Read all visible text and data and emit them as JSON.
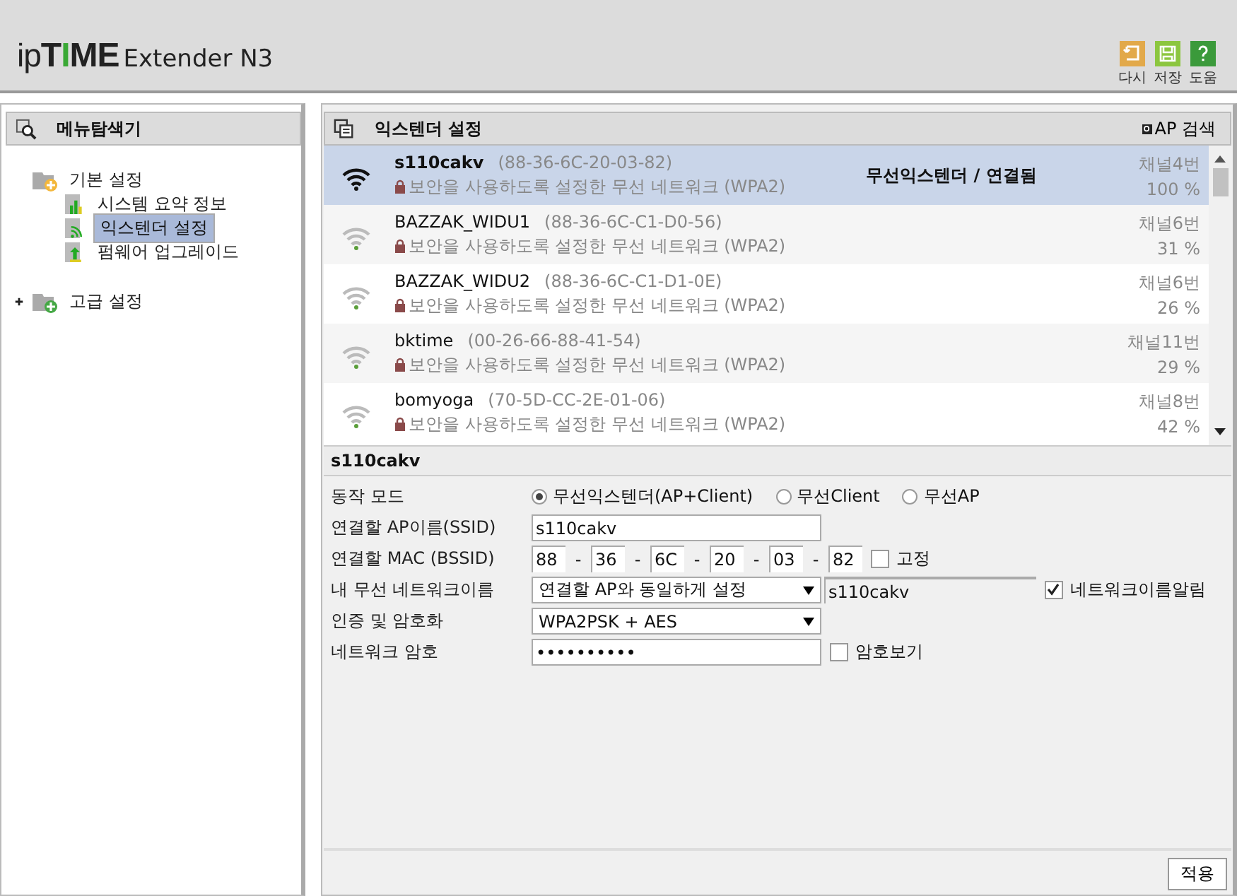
{
  "header": {
    "logo_parts": [
      {
        "text": "ip",
        "color": "#222222"
      },
      {
        "text": "T",
        "color": "#222222"
      },
      {
        "text": "I",
        "color": "#3aa935"
      },
      {
        "text": "ME",
        "color": "#222222"
      }
    ],
    "product": "Extender N3",
    "actions": [
      {
        "kind": "undo",
        "label": "다시"
      },
      {
        "kind": "save",
        "label": "저장"
      },
      {
        "kind": "help",
        "label": "도움"
      }
    ]
  },
  "sidebar": {
    "title": "메뉴탐색기",
    "tree": [
      {
        "label": "기본 설정",
        "kind": "folder",
        "expanded": true,
        "selected": false,
        "children": [
          {
            "label": "시스템 요약 정보",
            "kind": "chart",
            "selected": false
          },
          {
            "label": "익스텐더 설정",
            "kind": "wireless",
            "selected": true
          },
          {
            "label": "펌웨어 업그레이드",
            "kind": "upgrade",
            "selected": false
          }
        ]
      },
      {
        "label": "고급 설정",
        "kind": "folder-plus",
        "expanded": false,
        "selected": false
      }
    ]
  },
  "panel": {
    "title": "익스텐더 설정",
    "search_button": "AP 검색",
    "networks": [
      {
        "ssid": "s110cakv",
        "mac": "(88-36-6C-20-03-82)",
        "security": "보안을 사용하도록 설정한 무선 네트워크 (WPA2)",
        "status": "무선익스텐더 / 연결됨",
        "channel": "채널4번",
        "signal": "100 %",
        "selected": true
      },
      {
        "ssid": "BAZZAK_WIDU1",
        "mac": "(88-36-6C-C1-D0-56)",
        "security": "보안을 사용하도록 설정한 무선 네트워크 (WPA2)",
        "channel": "채널6번",
        "signal": "31 %",
        "selected": false
      },
      {
        "ssid": "BAZZAK_WIDU2",
        "mac": "(88-36-6C-C1-D1-0E)",
        "security": "보안을 사용하도록 설정한 무선 네트워크 (WPA2)",
        "channel": "채널6번",
        "signal": "26 %",
        "selected": false
      },
      {
        "ssid": "bktime",
        "mac": "(00-26-66-88-41-54)",
        "security": "보안을 사용하도록 설정한 무선 네트워크 (WPA2)",
        "channel": "채널11번",
        "signal": "29 %",
        "selected": false
      },
      {
        "ssid": "bomyoga",
        "mac": "(70-5D-CC-2E-01-06)",
        "security": "보안을 사용하도록 설정한 무선 네트워크 (WPA2)",
        "channel": "채널8번",
        "signal": "42 %",
        "selected": false
      }
    ]
  },
  "form": {
    "title": "s110cakv",
    "rows": [
      {
        "kind": "radio",
        "label": "동작 모드",
        "options": [
          {
            "label": "무선익스텐더(AP+Client)",
            "selected": true
          },
          {
            "label": "무선Client",
            "selected": false
          },
          {
            "label": "무선AP",
            "selected": false
          }
        ]
      },
      {
        "kind": "text",
        "label": "연결할 AP이름(SSID)",
        "value": "s110cakv"
      },
      {
        "kind": "mac",
        "label": "연결할 MAC (BSSID)",
        "parts": [
          "88",
          "36",
          "6C",
          "20",
          "03",
          "82"
        ],
        "separator": "-",
        "checkbox": {
          "label": "고정",
          "checked": false
        }
      },
      {
        "kind": "select-text",
        "label": "내 무선 네트워크이름",
        "value": "연결할 AP와 동일하게 설정",
        "text": "s110cakv",
        "checkbox": {
          "label": "네트워크이름알림",
          "checked": true
        }
      },
      {
        "kind": "select",
        "label": "인증 및 암호화",
        "value": "WPA2PSK + AES"
      },
      {
        "kind": "password",
        "label": "네트워크 암호",
        "value": "••••••••••",
        "checkbox": {
          "label": "암호보기",
          "checked": false
        }
      }
    ],
    "apply_button": "적용"
  }
}
